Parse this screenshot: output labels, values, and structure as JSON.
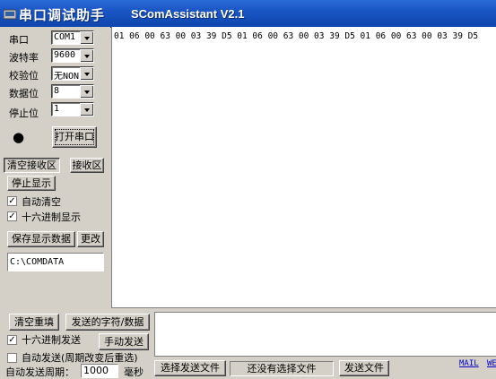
{
  "window": {
    "title_cn": "串口调试助手",
    "title_en": "SComAssistant V2.1"
  },
  "settings": [
    {
      "label": "串口",
      "value": "COM1"
    },
    {
      "label": "波特率",
      "value": "9600"
    },
    {
      "label": "校验位",
      "value": "无NONE"
    },
    {
      "label": "数据位",
      "value": "8"
    },
    {
      "label": "停止位",
      "value": "1"
    }
  ],
  "port": {
    "open_button": "打开串口",
    "status_indicator": "●"
  },
  "receive": {
    "clear_button": "清空接收区",
    "area_label": "接收区",
    "stop_display_button": "停止显示",
    "auto_clear_label": "自动清空",
    "auto_clear_checked": true,
    "hex_display_label": "十六进制显示",
    "hex_display_checked": true,
    "save_button": "保存显示数据",
    "change_button": "更改",
    "save_path": "C:\\COMDATA",
    "content": "01 06 00 63 00 03 39 D5 01 06 00 63 00 03 39 D5 01 06 00 63 00 03 39 D5"
  },
  "send": {
    "clear_button": "清空重填",
    "chars_label": "发送的字符/数据",
    "hex_send_label": "十六进制发送",
    "hex_send_checked": true,
    "manual_button": "手动发送",
    "auto_send_label": "自动发送(周期改变后重选)",
    "auto_send_checked": false,
    "period_label": "自动发送周期：",
    "period_value": "1000",
    "period_unit": "毫秒",
    "select_file_button": "选择发送文件",
    "file_status": "还没有选择文件",
    "send_file_button": "发送文件",
    "mail_link": "MAIL",
    "web_link": "WE"
  }
}
